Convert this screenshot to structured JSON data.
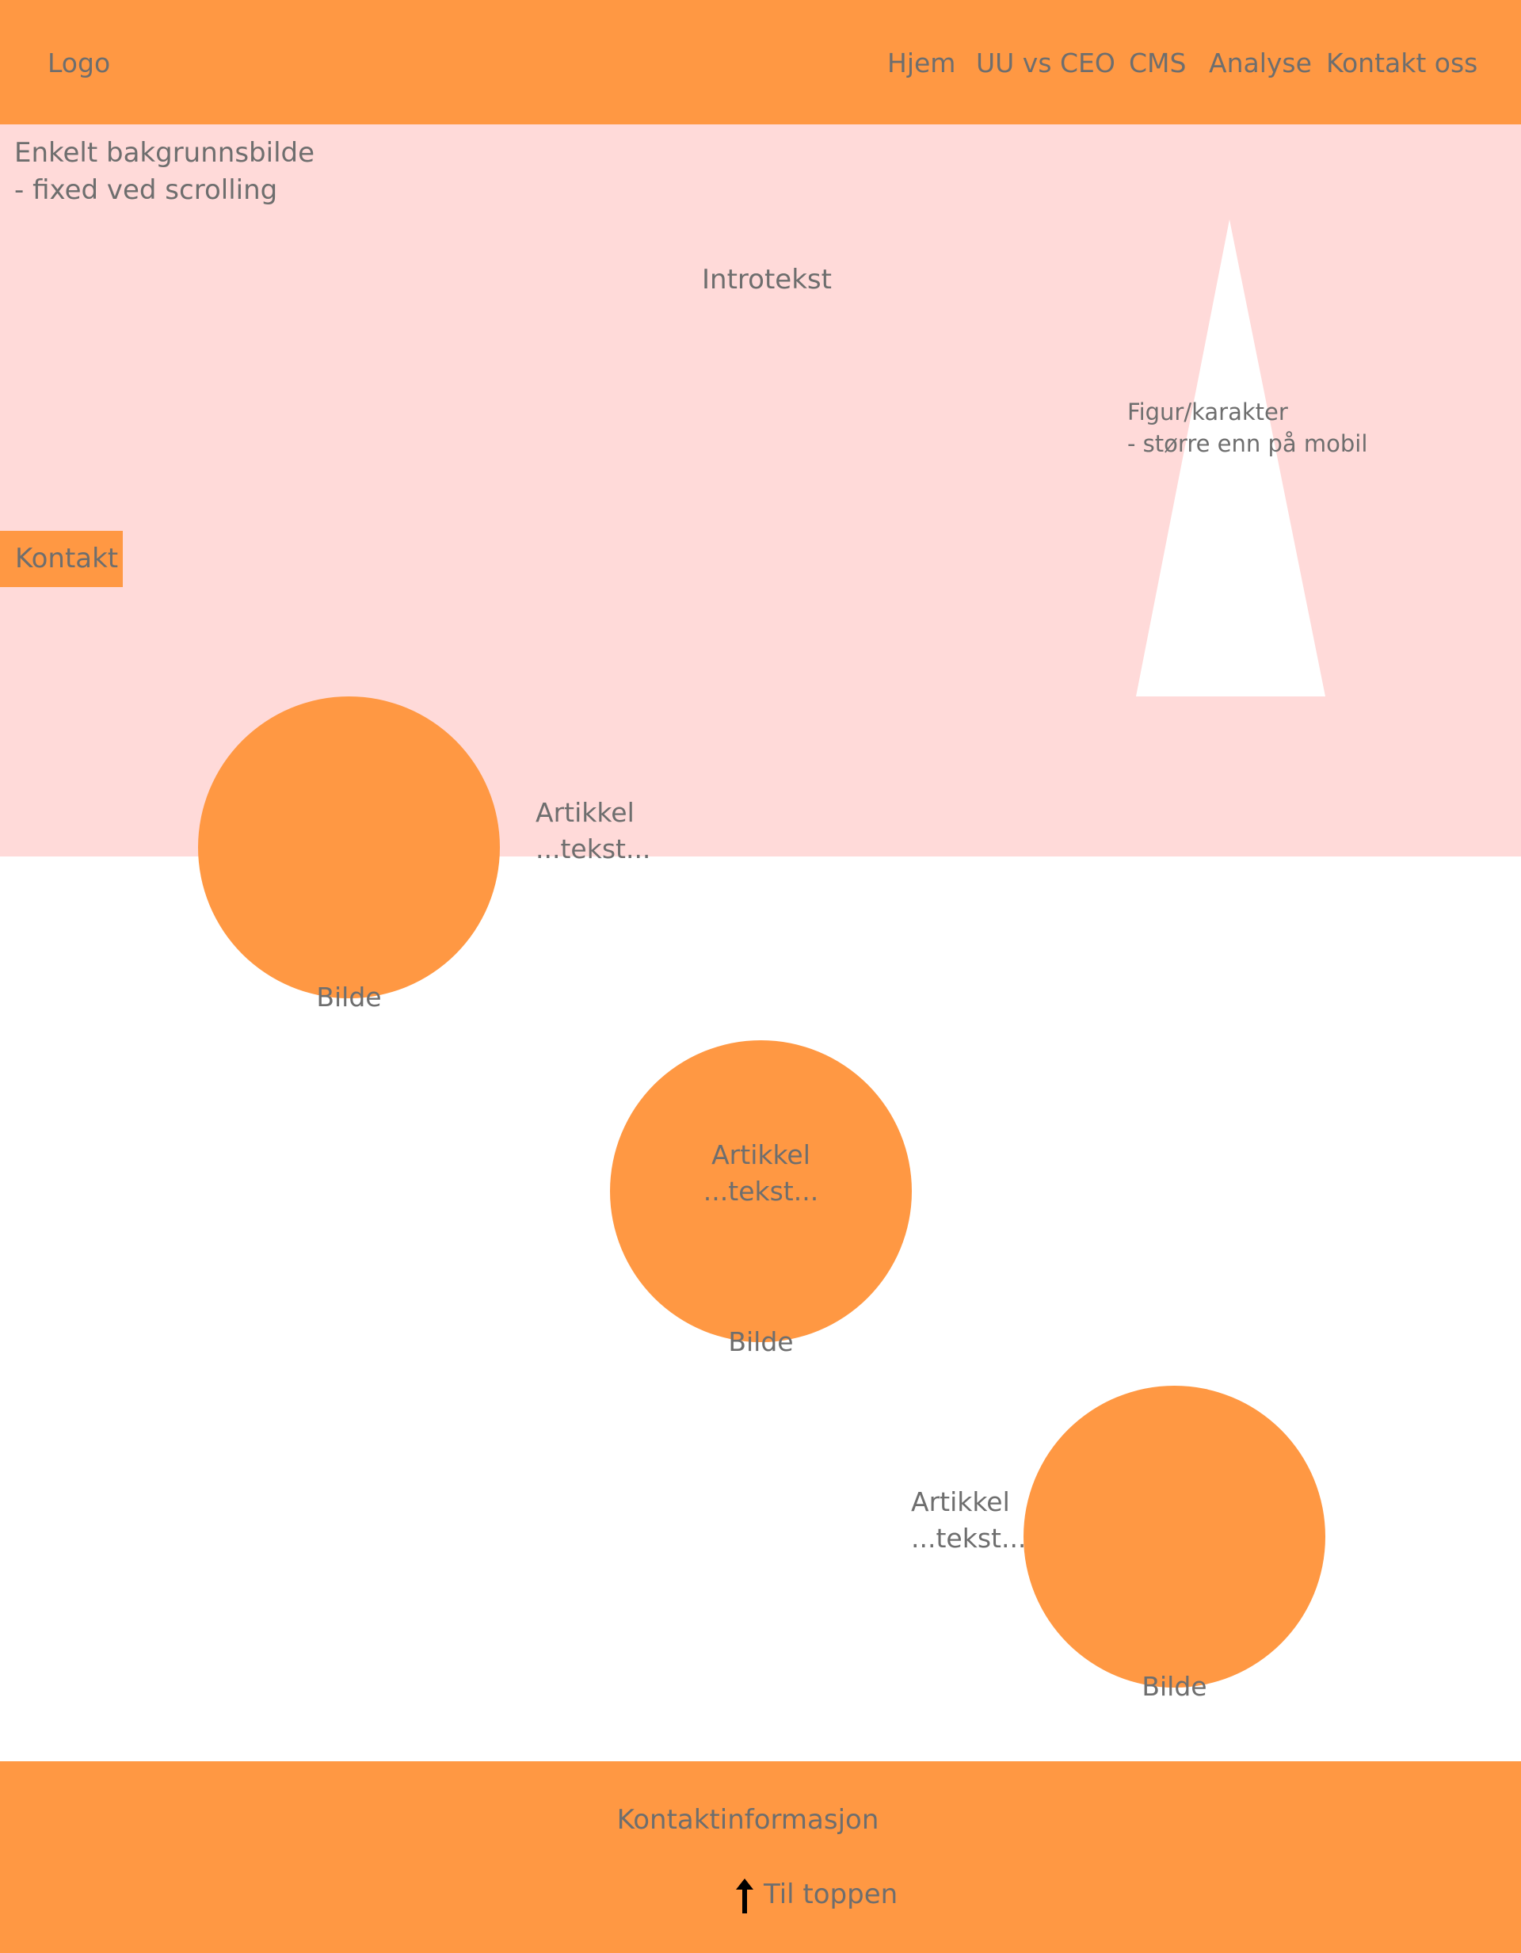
{
  "header": {
    "logo": "Logo",
    "nav": [
      "Hjem",
      "UU vs CEO",
      "CMS",
      "Analyse",
      "Kontakt oss"
    ]
  },
  "hero": {
    "background_note": [
      "Enkelt bakgrunnsbilde",
      "- fixed ved scrolling"
    ],
    "intro": "Introtekst",
    "figure_note": [
      "Figur/karakter",
      "- større enn på mobil"
    ],
    "kontakt_tab": "Kontakt"
  },
  "articles": [
    {
      "title": "Artikkel",
      "text": "...tekst...",
      "image_caption": "Bilde"
    },
    {
      "title": "Artikkel",
      "text": "...tekst...",
      "image_caption": "Bilde"
    },
    {
      "title": "Artikkel",
      "text": "...tekst...",
      "image_caption": "Bilde"
    }
  ],
  "footer": {
    "contact_info": "Kontaktinformasjon",
    "to_top": "Til toppen",
    "to_top_icon": "arrow-up-icon"
  },
  "colors": {
    "accent": "#ff9843",
    "hero_background": "#ffdad9",
    "figure": "#ffffff",
    "text": "#6e6e6e"
  }
}
